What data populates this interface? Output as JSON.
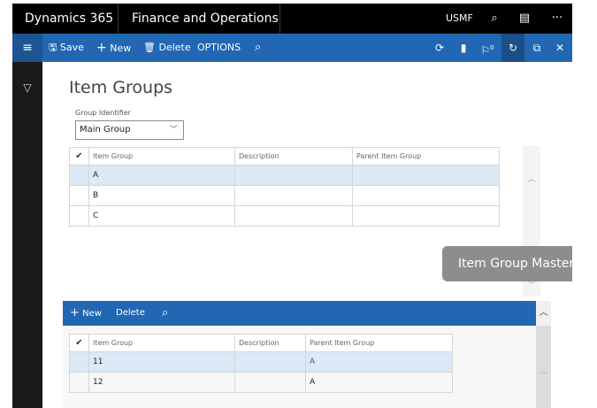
{
  "topbar": {
    "brand": "Dynamics 365",
    "module": "Finance and Operations",
    "company": "USMF",
    "icons": [
      "search-icon",
      "chat-icon",
      "more-icon"
    ],
    "search_glyph": "⌕",
    "chat_glyph": "▤",
    "more_glyph": "···"
  },
  "actionbar": {
    "menu_glyph": "≡",
    "save": "Save",
    "new": "New",
    "delete": "Delete",
    "options": "OPTIONS",
    "save_glyph": "🖫",
    "new_glyph": "+",
    "delete_glyph": "🗑",
    "search_glyph": "⌕",
    "right_glyphs": [
      "⟳",
      "▮",
      "⚐",
      "↻",
      "⧉",
      "✕"
    ],
    "badge": "0"
  },
  "leftrail": {
    "filter_glyph": "▽"
  },
  "page": {
    "title": "Item Groups",
    "group_identifier_label": "Group Identifier",
    "group_identifier_value": "Main Group",
    "chevron": "﹀"
  },
  "upper_grid": {
    "check": "✔",
    "columns": [
      "Item Group",
      "Description",
      "Parent Item Group"
    ],
    "rows": [
      {
        "item_group": "A",
        "description": "",
        "parent": ""
      },
      {
        "item_group": "B",
        "description": "",
        "parent": ""
      },
      {
        "item_group": "C",
        "description": "",
        "parent": ""
      }
    ],
    "scroll_up": "︿",
    "scroll_down": "﹀"
  },
  "tooltip": {
    "text": "Item Group Master"
  },
  "lower_bar": {
    "new_glyph": "+",
    "new": "New",
    "delete": "Delete",
    "search_glyph": "⌕",
    "collapse_glyph": "︿"
  },
  "lower_grid": {
    "check": "✔",
    "columns": [
      "Item Group",
      "Description",
      "Parent Item Group"
    ],
    "rows": [
      {
        "item_group": "11",
        "description": "",
        "parent": "A"
      },
      {
        "item_group": "12",
        "description": "",
        "parent": "A"
      }
    ],
    "scroll_up": "︿"
  },
  "colors": {
    "accent": "#2167b3",
    "topbar": "#000000",
    "selected_row": "#dce9f6",
    "tooltip": "#8d8d8d"
  }
}
